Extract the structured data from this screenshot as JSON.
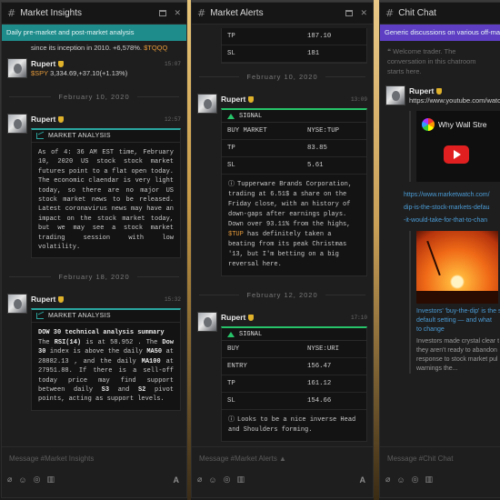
{
  "panels": {
    "insights": {
      "title": "Market Insights",
      "banner": "Daily pre-market and post-market analysis",
      "composer_placeholder": "Message #Market Insights",
      "top_snippet": "since its inception in 2010. +6,578%.",
      "top_ticker": "$TQQQ",
      "msg1": {
        "author": "Rupert",
        "time": "15:07",
        "ticker": "$SPY",
        "text": " 3,334.69,+37.10(+1.13%)"
      },
      "date1": "February 10, 2020",
      "msg2": {
        "author": "Rupert",
        "time": "12:57",
        "card_title": "MARKET ANALYSIS",
        "body": "As of 4: 36 AM EST time, February 10, 2020 US stock stock market futures point to a flat open today. The economic claendar is very light today, so there are no major US stock market news to be released. Latest coronavirus news may have an impact on the stock market today, but we may see a stock market trading session with low volatility."
      },
      "date2": "February 18, 2020",
      "msg3": {
        "author": "Rupert",
        "time": "15:32",
        "card_title": "MARKET ANALYSIS",
        "heading": "DOW 30 technical analysis summary",
        "p1": "The ",
        "rsi": "RSI(14)",
        "p2": " is at 58.952 . The ",
        "dow": "Dow 30",
        "p3": " index is above the daily ",
        "ma50": "MA50",
        "p4": " at 28882.13 , and the daily ",
        "ma100": "MA100",
        "p5": " at 27951.88. If there is a sell-off today price may find support between daily ",
        "s3": "S3",
        "p6": " and ",
        "s2": "S2",
        "p7": " pivot points, acting as support levels."
      }
    },
    "alerts": {
      "title": "Market Alerts",
      "composer_placeholder": "Message #Market Alerts",
      "top_rows": [
        {
          "k": "TP",
          "v": "187.10"
        },
        {
          "k": "SL",
          "v": "181"
        }
      ],
      "date1": "February 10, 2020",
      "msg1": {
        "author": "Rupert",
        "time": "13:09",
        "signal": "SIGNAL",
        "rows": [
          {
            "k": "BUY MARKET",
            "v": "NYSE:TUP"
          },
          {
            "k": "TP",
            "v": "83.85"
          },
          {
            "k": "SL",
            "v": "5.61"
          }
        ],
        "note": "Tupperware Brands Corporation, trading at 6.51$ a share on the Friday close, with an history of down-gaps after earnings plays. Down over 93.11% from the highs, ",
        "note_ticker": "$TUP",
        "note_end": " has definitely taken a beating from its peak Christmas '13, but I'm betting on a big reversal here."
      },
      "date2": "February 12, 2020",
      "msg2": {
        "author": "Rupert",
        "time": "17:10",
        "signal": "SIGNAL",
        "rows": [
          {
            "k": "BUY",
            "v": "NYSE:URI"
          },
          {
            "k": "ENTRY",
            "v": "156.47"
          },
          {
            "k": "TP",
            "v": "161.12"
          },
          {
            "k": "SL",
            "v": "154.66"
          }
        ],
        "note": "Looks to be a nice inverse Head and Shoulders forming."
      }
    },
    "chat": {
      "title": "Chit Chat",
      "banner": "Generic discussions on various off-mar",
      "composer_placeholder": "Message #Chit Chat",
      "welcome": "Welcome trader. The conversation in this chatroom starts here.",
      "msg1": {
        "author": "Rupert",
        "link1": "https://www.youtube.com/watch",
        "video_title": "Why Wall Stre",
        "link2a": "https://www.marketwatch.com/",
        "link2b": "dip-is-the-stock-markets-defau",
        "link2c": "-it-would-take-for-that-to-chan",
        "article_title_a": "Investors' 'buy-the-dip' is the stoc",
        "article_title_b": "default setting — and what",
        "article_title_c": "to change",
        "article_desc": "Investors made crystal clear t they aren't ready to abandon response to stock market pul warnings the..."
      }
    }
  }
}
